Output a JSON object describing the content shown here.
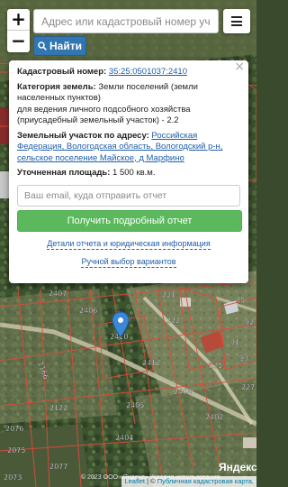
{
  "search": {
    "placeholder": "Адрес или кадастровый номер участка",
    "button_label": "Найти"
  },
  "zoom": {
    "in": "+",
    "out": "−"
  },
  "popup": {
    "close": "×",
    "cadastral_label": "Кадастровый номер:",
    "cadastral_number": "35:25:0501037:2410",
    "category_label": "Категория земель:",
    "category_value": "Земли поселений (земли населенных пунктов)",
    "usage": "для ведения личного подсобного хозяйства (приусадебный земельный участок) - 2.2",
    "address_label": "Земельный участок по адресу:",
    "address_value": "Российская Федерация, Вологодская область, Вологодский р-н, сельское поселение Майское, д Марфино",
    "area_label": "Уточненная площадь:",
    "area_value": "1 500 кв.м.",
    "email_placeholder": "Ваш email, куда отправить отчет",
    "report_button": "Получить подробный отчет",
    "link_details": "Детали отчета и юридическая информация",
    "link_manual": "Ручной выбор вариантов"
  },
  "map_labels": {
    "parcel_2407": "2407",
    "parcel_221": "221",
    "parcel_222": "222",
    "parcel_2406": "2406",
    "parcel_2410": "2410",
    "parcel_2412": "2412",
    "parcel_2404": "2404",
    "parcel_2402": "2402",
    "parcel_2405": "2405",
    "parcel_2404b": "2404",
    "parcel_2076": "2076",
    "parcel_2075": "2075",
    "parcel_2077": "2077",
    "parcel_2073": "2073",
    "parcel_2122": "2122",
    "parcel_1166": "1166",
    "parcel_225": "225",
    "parcel_227": "227",
    "parcel_91": "91",
    "parcel_92": "92",
    "parcel_93": "93",
    "parcel_95": "95"
  },
  "attribution": {
    "leaflet": "Leaflet",
    "separator": " | © ",
    "source": "Публичная кадастровая карта,",
    "map_copyright": "© 2023 ООО «Яндекс» Условия использования",
    "logo": "Яндекс"
  },
  "colors": {
    "accent_blue": "#3276b1",
    "report_green": "#5cb85c",
    "parcel_line": "#e04b3a",
    "marker": "#3a88d6"
  }
}
